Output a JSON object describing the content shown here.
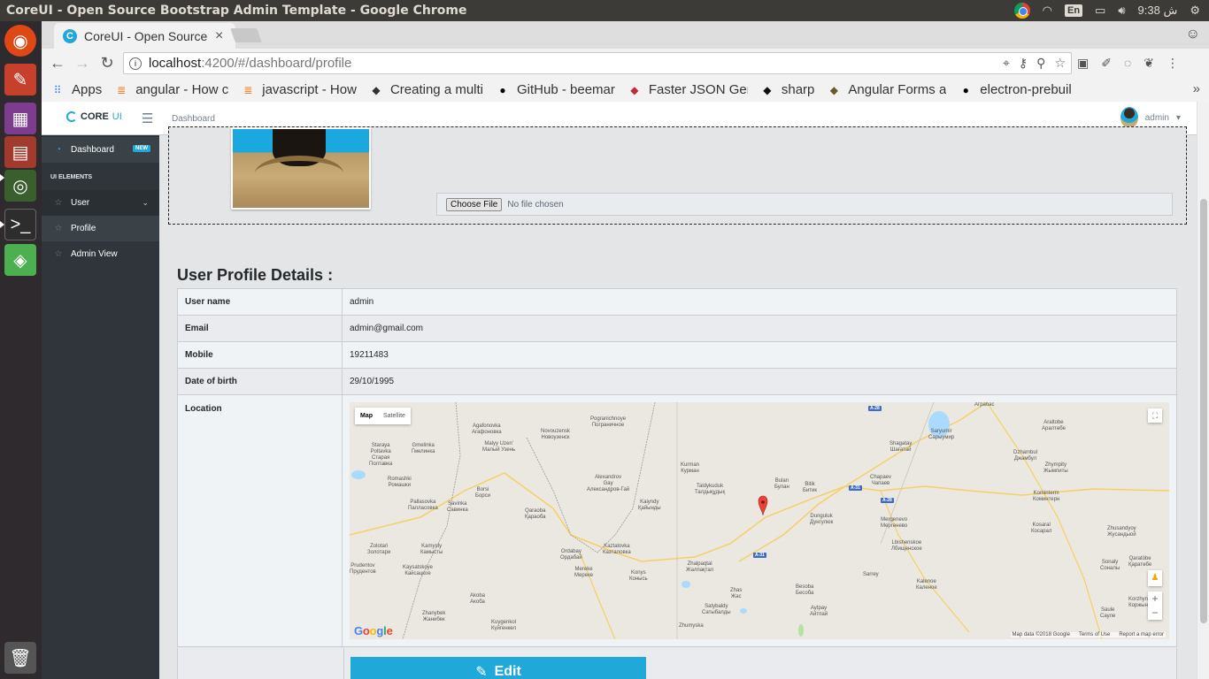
{
  "os": {
    "window_title": "CoreUI - Open Source Bootstrap Admin Template - Google Chrome",
    "keyboard_layout": "En",
    "clock": "9:38 ش"
  },
  "browser": {
    "tab_title": "CoreUI - Open Source Bootstrap Admin Template",
    "url_host": "localhost",
    "url_rest": ":4200/#/dashboard/profile",
    "bookmarks": [
      {
        "label": "Apps",
        "icon": "apps-grid-icon",
        "color": "#4285f4"
      },
      {
        "label": "angular - How c",
        "icon": "stackoverflow-icon",
        "color": "#f48024"
      },
      {
        "label": "javascript - How",
        "icon": "stackoverflow-icon",
        "color": "#f48024"
      },
      {
        "label": "Creating a multi",
        "icon": "bookmark-site-icon",
        "color": "#333333"
      },
      {
        "label": "GitHub - beemar",
        "icon": "github-icon",
        "color": "#000000"
      },
      {
        "label": "Faster JSON Ger",
        "icon": "bookmark-site-icon",
        "color": "#c5283d"
      },
      {
        "label": "sharp",
        "icon": "bookmark-site-icon",
        "color": "#111111"
      },
      {
        "label": "Angular Forms a",
        "icon": "bookmark-site-icon",
        "color": "#6b5a2a"
      },
      {
        "label": "electron-prebuil",
        "icon": "github-icon",
        "color": "#000000"
      }
    ]
  },
  "app": {
    "brand_core": "CORE",
    "brand_ui": "UI",
    "breadcrumb": "Dashboard",
    "user_name": "admin"
  },
  "sidebar": {
    "dashboard": "Dashboard",
    "badge": "NEW",
    "section_title": "UI ELEMENTS",
    "items": [
      "User",
      "Profile",
      "Admin View"
    ]
  },
  "upload": {
    "choose_label": "Choose File",
    "status": "No file chosen"
  },
  "profile": {
    "title": "User Profile Details :",
    "rows": [
      {
        "label": "User name",
        "value": "admin"
      },
      {
        "label": "Email",
        "value": "admin@gmail.com"
      },
      {
        "label": "Mobile",
        "value": "19211483"
      },
      {
        "label": "Date of birth",
        "value": "29/10/1995"
      }
    ],
    "location_label": "Location",
    "edit_label": "Edit"
  },
  "map": {
    "type_map": "Map",
    "type_satellite": "Satellite",
    "attribution": "Map data ©2018 Google",
    "terms": "Terms of Use",
    "report": "Report a map error",
    "logo": "Google"
  },
  "colors": {
    "accent": "#20a8d8",
    "sidebar_bg": "#2f353a",
    "map_road": "#f6cf65",
    "map_marker": "#ea4335"
  }
}
